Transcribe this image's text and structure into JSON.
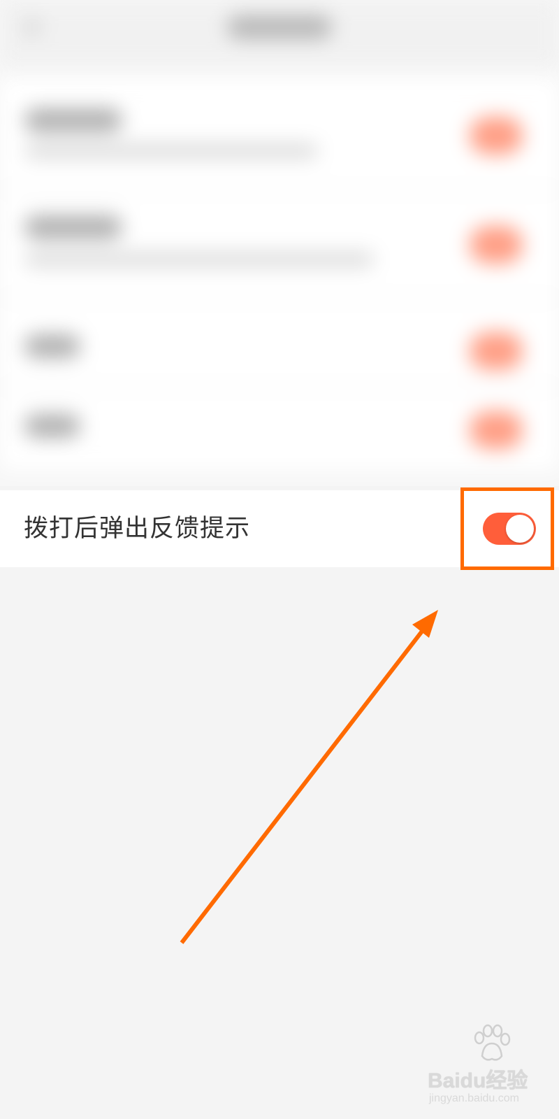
{
  "settings": {
    "feedback_prompt_label": "拨打后弹出反馈提示",
    "feedback_prompt_enabled": true
  },
  "colors": {
    "accent": "#ff5e3a",
    "annotation": "#ff6a00",
    "page_background": "#f4f4f4"
  },
  "watermark": {
    "brand": "Baidu经验",
    "url": "jingyan.baidu.com"
  },
  "icons": {
    "watermark_logo": "paw-icon"
  }
}
